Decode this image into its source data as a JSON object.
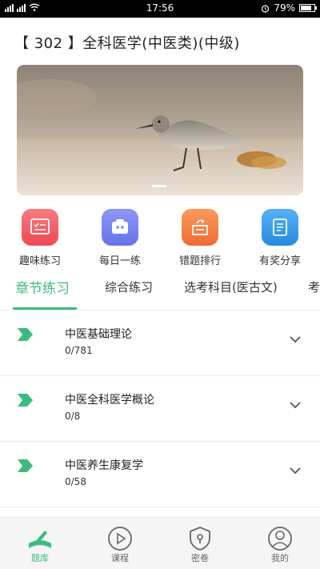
{
  "status_bar": {
    "time": "17:56",
    "battery": "79%",
    "battery_level": 0.79,
    "icons": [
      "signal-icon",
      "wifi-icon",
      "alarm-icon",
      "battery-icon"
    ]
  },
  "page": {
    "title": "【 302 】全科医学(中医类)(中级)"
  },
  "banner": {
    "subject": "bird-photo",
    "indicator_count": 1
  },
  "quick_actions": [
    {
      "label": "趣味练习",
      "icon": "quiz-icon",
      "color": "#f0545e"
    },
    {
      "label": "每日一练",
      "icon": "daily-icon",
      "color": "#6f7cf0"
    },
    {
      "label": "错题排行",
      "icon": "ranking-icon",
      "color": "#f57a3f"
    },
    {
      "label": "有奖分享",
      "icon": "share-icon",
      "color": "#2f96e8"
    }
  ],
  "tabs": [
    {
      "label": "章节练习",
      "active": true
    },
    {
      "label": "综合练习",
      "active": false
    },
    {
      "label": "选考科目(医古文)",
      "active": false
    },
    {
      "label": "考",
      "active": false
    }
  ],
  "chapters": [
    {
      "name": "中医基础理论",
      "progress": "0/781"
    },
    {
      "name": "中医全科医学概论",
      "progress": "0/8"
    },
    {
      "name": "中医养生康复学",
      "progress": "0/58"
    }
  ],
  "bottom_nav": [
    {
      "label": "题库",
      "icon": "question-bank-icon",
      "active": true
    },
    {
      "label": "课程",
      "icon": "play-icon",
      "active": false
    },
    {
      "label": "密卷",
      "icon": "lock-shield-icon",
      "active": false
    },
    {
      "label": "我的",
      "icon": "user-icon",
      "active": false
    }
  ],
  "colors": {
    "accent": "#3dbb7f",
    "text": "#222222",
    "divider": "#ececec"
  }
}
